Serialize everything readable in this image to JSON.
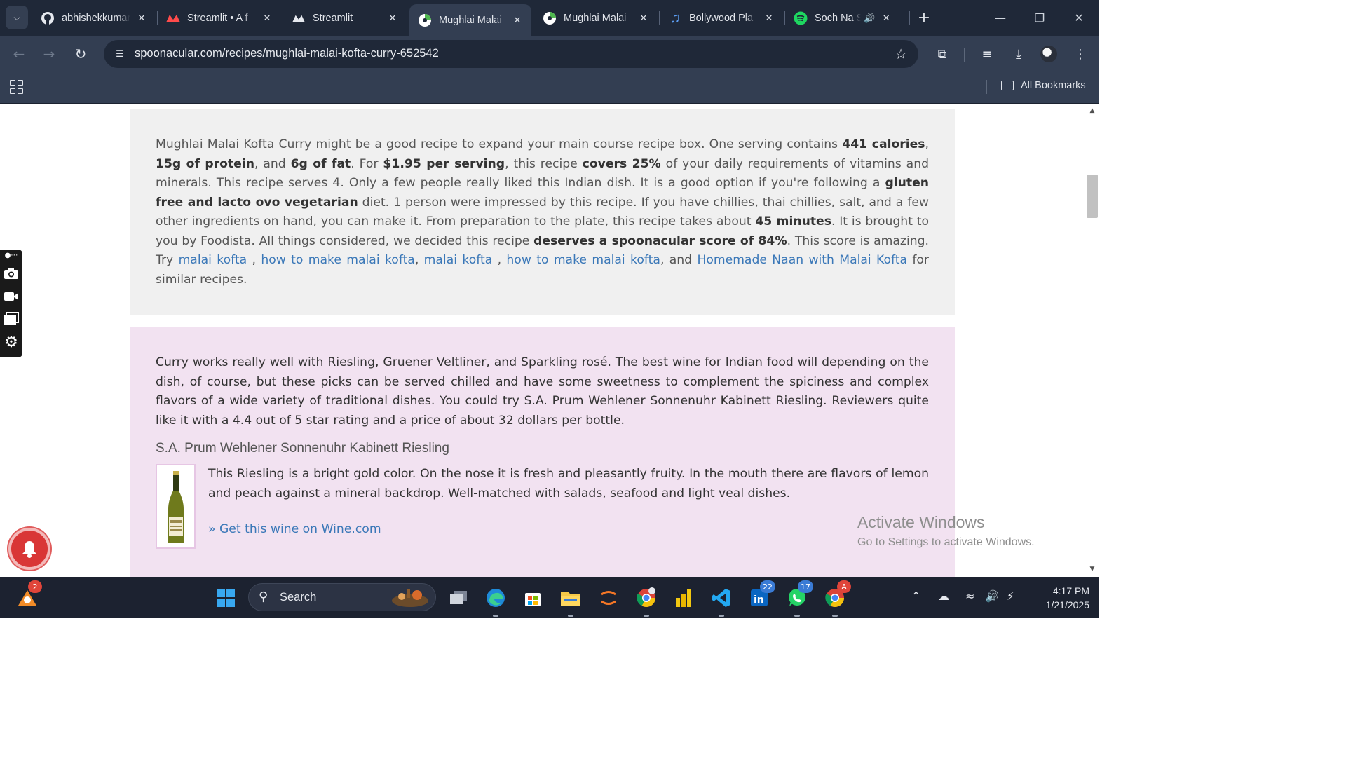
{
  "browser": {
    "tabs": [
      {
        "title": "abhishekkumar",
        "icon": "github-icon",
        "active": false
      },
      {
        "title": "Streamlit • A f",
        "icon": "streamlit-icon",
        "active": false
      },
      {
        "title": "Streamlit",
        "icon": "streamlit-icon",
        "active": false
      },
      {
        "title": "Mughlai Malai",
        "icon": "spoonacular-icon",
        "active": true
      },
      {
        "title": "Mughlai Malai",
        "icon": "spoonacular-icon",
        "active": false
      },
      {
        "title": "Bollywood Pla",
        "icon": "music-note-icon",
        "active": false
      },
      {
        "title": "Soch Na S",
        "icon": "spotify-icon",
        "active": false
      }
    ],
    "url": "spoonacular.com/recipes/mughlai-malai-kofta-curry-652542",
    "bookmarks_label": "All Bookmarks"
  },
  "summary": {
    "t1": "Mughlai Malai Kofta Curry might be a good recipe to expand your main course recipe box. One serving contains ",
    "b1": "441 calories",
    "t2": ", ",
    "b2": "15g of protein",
    "t3": ", and ",
    "b3": "6g of fat",
    "t4": ". For ",
    "b4": "$1.95 per serving",
    "t5": ", this recipe ",
    "b5": "covers 25%",
    "t6": " of your daily requirements of vitamins and minerals. This recipe serves 4. Only a few people really liked this Indian dish. It is a good option if you're following a ",
    "b6": "gluten free and lacto ovo vegetarian",
    "t7": " diet. 1 person were impressed by this recipe. If you have chillies, thai chillies, salt, and a few other ingredients on hand, you can make it. From preparation to the plate, this recipe takes about ",
    "b7": "45 minutes",
    "t8": ". It is brought to you by Foodista. All things considered, we decided this recipe ",
    "b8": "deserves a spoonacular score of 84%",
    "t9": ". This score is amazing. Try ",
    "l1": "malai kofta ",
    "t10": ", ",
    "l2": "how to make malai kofta",
    "t11": ", ",
    "l3": "malai kofta ",
    "t12": ", ",
    "l4": "how to make malai kofta",
    "t13": ", and ",
    "l5": "Homemade Naan with Malai Kofta",
    "t14": " for similar recipes."
  },
  "wine": {
    "intro": "Curry works really well with Riesling, Gruener Veltliner, and Sparkling rosé. The best wine for Indian food will depending on the dish, of course, but these picks can be served chilled and have some sweetness to complement the spiciness and complex flavors of a wide variety of traditional dishes. You could try S.A. Prum Wehlener Sonnenuhr Kabinett Riesling. Reviewers quite like it with a 4.4 out of 5 star rating and a price of about 32 dollars per bottle.",
    "name": "S.A. Prum Wehlener Sonnenuhr Kabinett Riesling",
    "description": "This Riesling is a bright gold color. On the nose it is fresh and pleasantly fruity. In the mouth there are flavors of lemon and peach against a mineral backdrop. Well-matched with salads, seafood and light veal dishes.",
    "link": "» Get this wine on Wine.com"
  },
  "watermark": {
    "line1": "Activate Windows",
    "line2": "Go to Settings to activate Windows."
  },
  "taskbar": {
    "search_label": "Search",
    "badges": {
      "notify": "2",
      "linkedin": "22",
      "whatsapp": "17",
      "chrome_alert": "A"
    },
    "time": "4:17 PM",
    "date": "1/21/2025"
  },
  "colors": {
    "tab_strip": "#1f2838",
    "toolbar": "#333e52",
    "summary_bg": "#f0f0f0",
    "wine_bg": "#f2e2f1",
    "link": "#3b78b8",
    "taskbar": "#1c2230"
  }
}
